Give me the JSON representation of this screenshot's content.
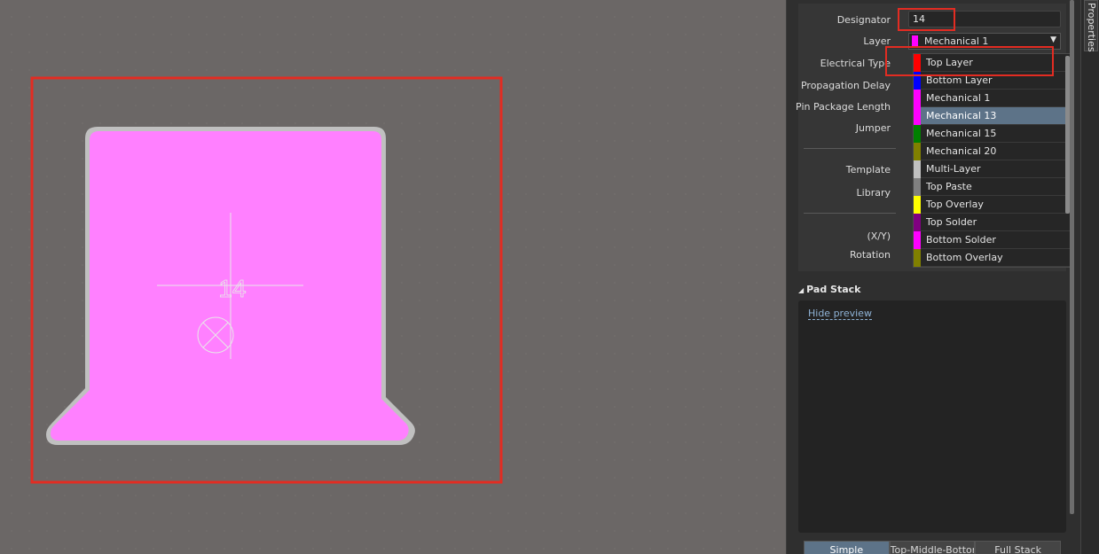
{
  "canvas": {
    "pad_designator": "14",
    "pad_color": "#ff80ff",
    "pad_outline_color": "#c0c0c0",
    "highlight_color": "#e32c22"
  },
  "properties": {
    "labels": {
      "designator": "Designator",
      "layer": "Layer",
      "electrical_type": "Electrical Type",
      "propagation_delay": "Propagation Delay",
      "pin_package_length": "Pin Package Length",
      "jumper": "Jumper",
      "template": "Template",
      "library": "Library",
      "xy": "(X/Y)",
      "rotation": "Rotation"
    },
    "designator_value": "14",
    "layer_value": "Mechanical 1",
    "layer_value_color": "#ff00ff"
  },
  "layer_dropdown": {
    "items": [
      {
        "label": "Top Layer",
        "color": "#ff0000"
      },
      {
        "label": "Bottom Layer",
        "color": "#0000ff"
      },
      {
        "label": "Mechanical 1",
        "color": "#ff00ff"
      },
      {
        "label": "Mechanical 13",
        "color": "#ff00ff"
      },
      {
        "label": "Mechanical 15",
        "color": "#008000"
      },
      {
        "label": "Mechanical 20",
        "color": "#808000"
      },
      {
        "label": "Multi-Layer",
        "color": "#c0c0c0"
      },
      {
        "label": "Top Paste",
        "color": "#808080"
      },
      {
        "label": "Top Overlay",
        "color": "#ffff00"
      },
      {
        "label": "Top Solder",
        "color": "#800080"
      },
      {
        "label": "Bottom Solder",
        "color": "#ff00ff"
      },
      {
        "label": "Bottom Overlay",
        "color": "#808000"
      }
    ],
    "selected_index": 3
  },
  "pad_stack": {
    "header": "Pad Stack",
    "hide_preview": "Hide preview",
    "tabs": [
      "Simple",
      "Top-Middle-Bottom",
      "Full Stack"
    ],
    "active_tab": 0
  },
  "side_panel": {
    "tab_label": "Properties"
  }
}
